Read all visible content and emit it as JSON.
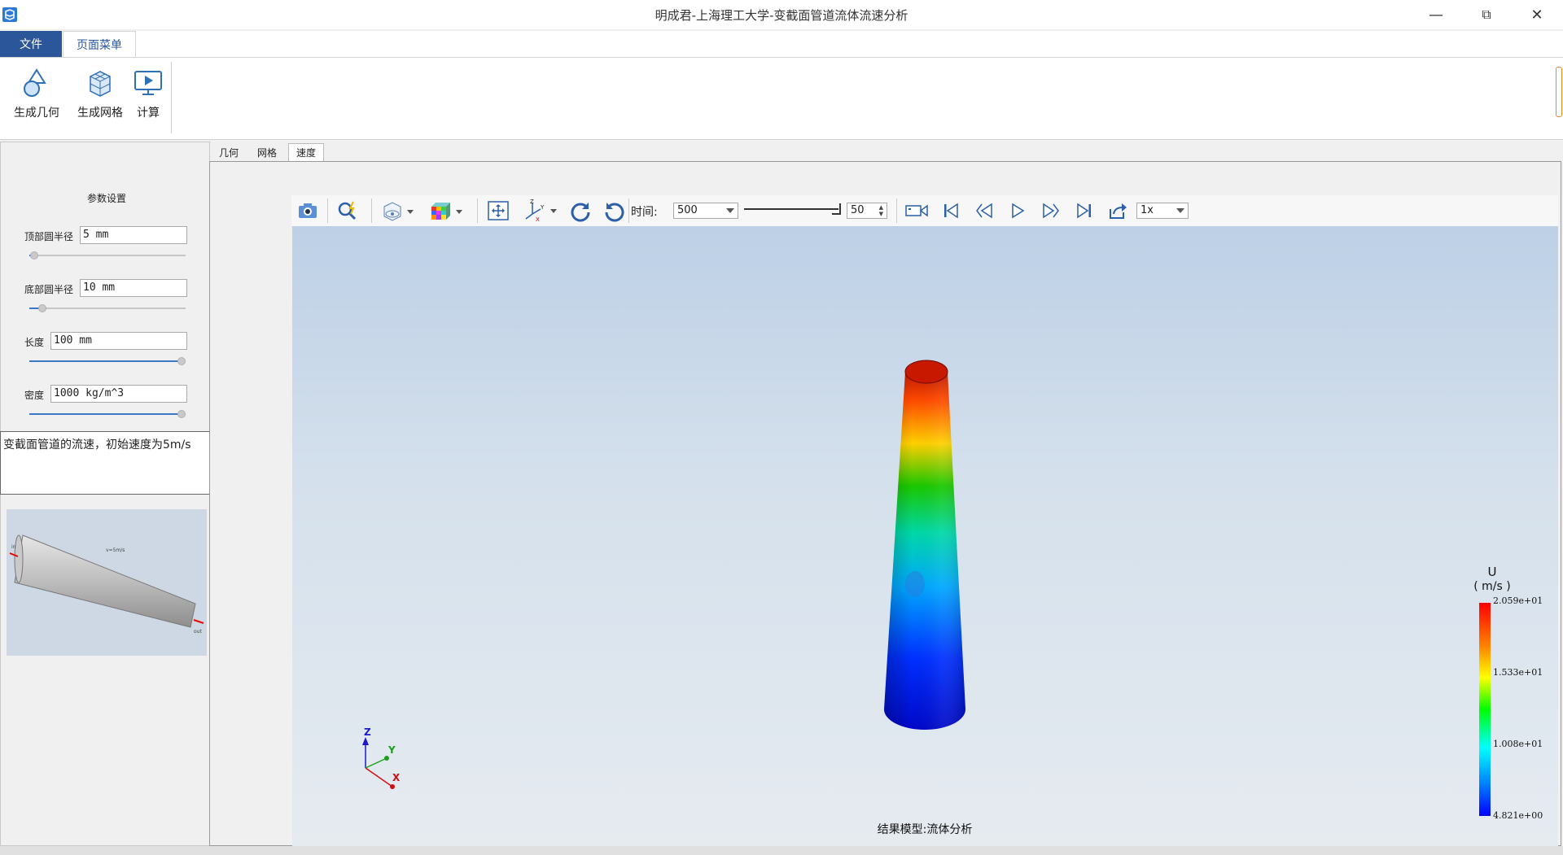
{
  "window": {
    "title": "明成君-上海理工大学-变截面管道流体流速分析"
  },
  "ribbon": {
    "tabs": [
      "文件",
      "页面菜单"
    ],
    "buttons": [
      {
        "label": "生成几何",
        "icon": "geometry-icon"
      },
      {
        "label": "生成网格",
        "icon": "mesh-icon"
      },
      {
        "label": "计算",
        "icon": "compute-icon"
      }
    ]
  },
  "params": {
    "title": "参数设置",
    "fields": [
      {
        "label": "顶部圆半径",
        "value": "5 mm",
        "slider_level": 0.03
      },
      {
        "label": "底部圆半径",
        "value": "10 mm",
        "slider_level": 0.08
      },
      {
        "label": "长度",
        "value": "100 mm",
        "slider_level": 1.0
      },
      {
        "label": "密度",
        "value": "1000 kg/m^3",
        "slider_level": 1.0
      }
    ],
    "description": "变截面管道的流速，初始速度为5m/s",
    "preview": {
      "inlet": "in",
      "outlet": "out",
      "velocity": "v=5m/s"
    }
  },
  "view_tabs": [
    "几何",
    "网格",
    "速度"
  ],
  "toolbar": {
    "time_label": "时间:",
    "time_value": "500",
    "frame_value": "50",
    "speed_value": "1x"
  },
  "viewport": {
    "result_label": "结果模型:流体分析",
    "axes": {
      "z": "Z",
      "y": "Y",
      "x": "X"
    },
    "legend": {
      "title": "U",
      "unit": "( m/s )",
      "ticks": [
        "2.059e+01",
        "1.533e+01",
        "1.008e+01",
        "4.821e+00"
      ]
    }
  },
  "colors": {
    "accent": "#2b579a",
    "legend_top": "#ff0000",
    "legend_bottom": "#0000ff"
  }
}
